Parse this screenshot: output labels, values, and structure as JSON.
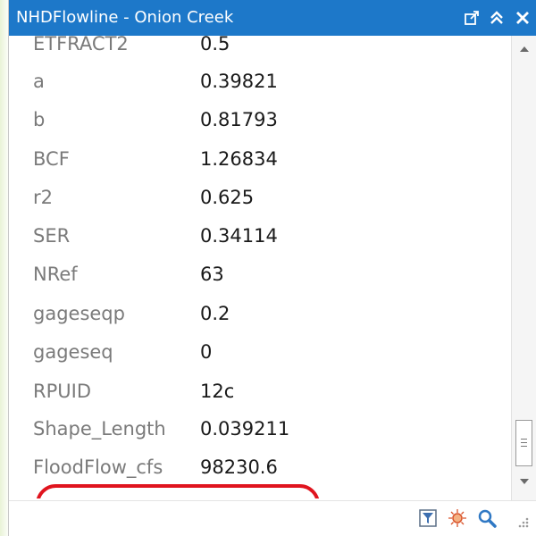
{
  "window": {
    "title": "NHDFlowline - Onion Creek"
  },
  "attributes": [
    {
      "field": "ETFRACT2",
      "value": "0.5"
    },
    {
      "field": "a",
      "value": "0.39821"
    },
    {
      "field": "b",
      "value": "0.81793"
    },
    {
      "field": "BCF",
      "value": "1.26834"
    },
    {
      "field": "r2",
      "value": "0.625"
    },
    {
      "field": "SER",
      "value": "0.34114"
    },
    {
      "field": "NRef",
      "value": "63"
    },
    {
      "field": "gageseqp",
      "value": "0.2"
    },
    {
      "field": "gageseq",
      "value": "0"
    },
    {
      "field": "RPUID",
      "value": "12c"
    },
    {
      "field": "Shape_Length",
      "value": "0.039211"
    },
    {
      "field": "FloodFlow_cfs",
      "value": "98230.6"
    }
  ],
  "colors": {
    "titlebar": "#1d78c9",
    "highlight": "#e0141e",
    "field_label": "#7a7a7a",
    "field_value": "#1a1a1a"
  },
  "icons": {
    "titlebar": [
      "pop-out-icon",
      "collapse-icon",
      "close-icon"
    ],
    "footer": [
      "filter-icon",
      "pan-to-icon",
      "zoom-to-icon",
      "resize-grip-icon"
    ]
  }
}
